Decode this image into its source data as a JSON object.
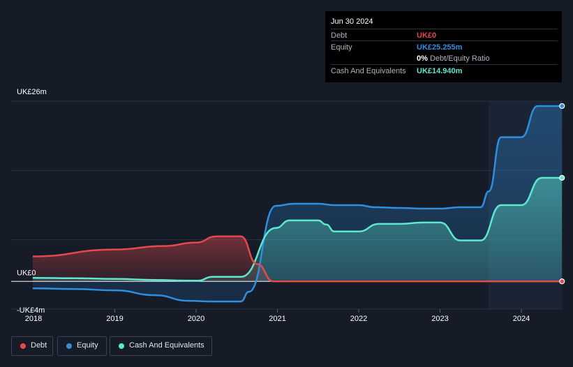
{
  "chart_data": {
    "type": "area",
    "x_tick_labels": [
      "2018",
      "2019",
      "2020",
      "2021",
      "2022",
      "2023",
      "2024"
    ],
    "y_tick_labels": [
      "UK£26m",
      "UK£0",
      "-UK£4m"
    ],
    "ylim": [
      -4,
      26
    ],
    "grid": true,
    "legend_position": "bottom-left",
    "series": [
      {
        "name": "Debt",
        "color": "#e5484d",
        "x": [
          2017.99,
          2019,
          2019.6,
          2020,
          2020.25,
          2020.55,
          2020.75,
          2020.95,
          2021.5,
          2022,
          2023,
          2024,
          2024.5
        ],
        "values": [
          3.6,
          4.6,
          5.1,
          5.6,
          6.5,
          6.5,
          2.5,
          0,
          0,
          0,
          0,
          0,
          0
        ]
      },
      {
        "name": "Equity",
        "color": "#2e8fe0",
        "x": [
          2017.99,
          2018.5,
          2019,
          2019.5,
          2019.9,
          2020.2,
          2020.55,
          2020.65,
          2020.98,
          2021.2,
          2021.5,
          2021.7,
          2022,
          2022.2,
          2022.5,
          2022.8,
          2023,
          2023.25,
          2023.5,
          2023.6,
          2023.75,
          2024,
          2024.2,
          2024.5
        ],
        "values": [
          -1.0,
          -1.1,
          -1.3,
          -2.0,
          -2.8,
          -2.9,
          -2.9,
          -1.5,
          10.9,
          11.2,
          11.2,
          11.0,
          11.0,
          10.7,
          10.6,
          10.5,
          10.5,
          10.7,
          10.7,
          13.0,
          20.8,
          20.8,
          25.3,
          25.3
        ]
      },
      {
        "name": "Cash And Equivalents",
        "color": "#5ee8cf",
        "x": [
          2017.99,
          2018.5,
          2019,
          2019.5,
          2019.9,
          2020.02,
          2020.2,
          2020.55,
          2020.98,
          2021.15,
          2021.5,
          2021.6,
          2021.7,
          2022,
          2022.25,
          2022.5,
          2022.8,
          2023,
          2023.25,
          2023.5,
          2023.75,
          2024,
          2024.25,
          2024.5
        ],
        "values": [
          0.5,
          0.45,
          0.35,
          0.2,
          0.1,
          0.1,
          0.65,
          0.65,
          7.7,
          8.8,
          8.8,
          8.2,
          7.2,
          7.2,
          8.3,
          8.3,
          8.5,
          8.5,
          5.9,
          5.9,
          11.0,
          11.0,
          14.94,
          14.94
        ]
      }
    ]
  },
  "tooltip": {
    "date": "Jun 30 2024",
    "rows": [
      {
        "label": "Debt",
        "value": "UK£0",
        "color": "#e5484d"
      },
      {
        "label": "Equity",
        "value": "UK£25.255m",
        "color": "#2e8fe0"
      },
      {
        "label": "",
        "value": "0%",
        "sub": "Debt/Equity Ratio",
        "color": "#ffffff"
      },
      {
        "label": "Cash And Equivalents",
        "value": "UK£14.940m",
        "color": "#5ee8cf"
      }
    ]
  },
  "legend": [
    {
      "label": "Debt",
      "color": "#e5484d"
    },
    {
      "label": "Equity",
      "color": "#2e8fe0"
    },
    {
      "label": "Cash And Equivalents",
      "color": "#5ee8cf"
    }
  ]
}
